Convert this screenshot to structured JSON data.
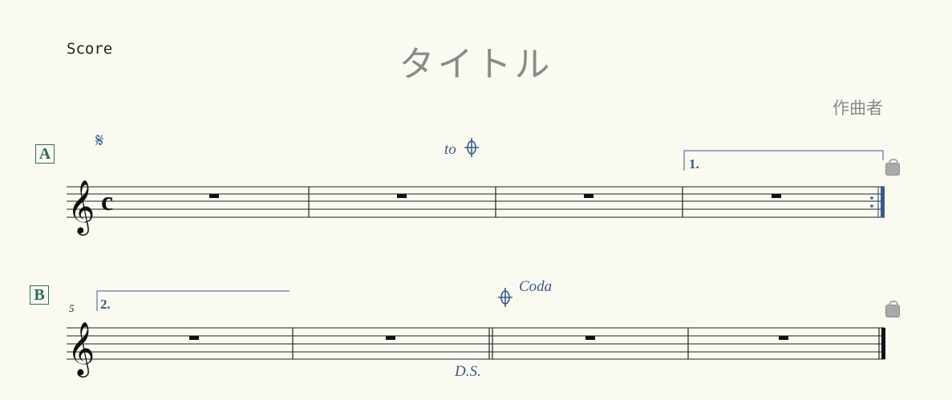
{
  "header": {
    "part_label": "Score",
    "title": "タイトル",
    "composer": "作曲者"
  },
  "system1": {
    "rehearsal_mark": "A",
    "segno_icon": "segno-icon",
    "to_coda_text": "to",
    "coda_icon": "coda-icon",
    "volta_label": "1.",
    "time_signature": "c",
    "measures": 4,
    "measure_rest_icon": "whole-rest-icon",
    "end_barline": "repeat-end"
  },
  "system2": {
    "rehearsal_mark": "B",
    "measure_number": "5",
    "volta_label": "2.",
    "coda_text": "Coda",
    "ds_text": "D.S.",
    "measures": 4,
    "end_barline": "final"
  },
  "colors": {
    "background": "#fbfaf1",
    "annotation_blue": "#3a5a88",
    "rehearsal_green": "#2e6b58",
    "title_gray": "#8a8a8a"
  }
}
